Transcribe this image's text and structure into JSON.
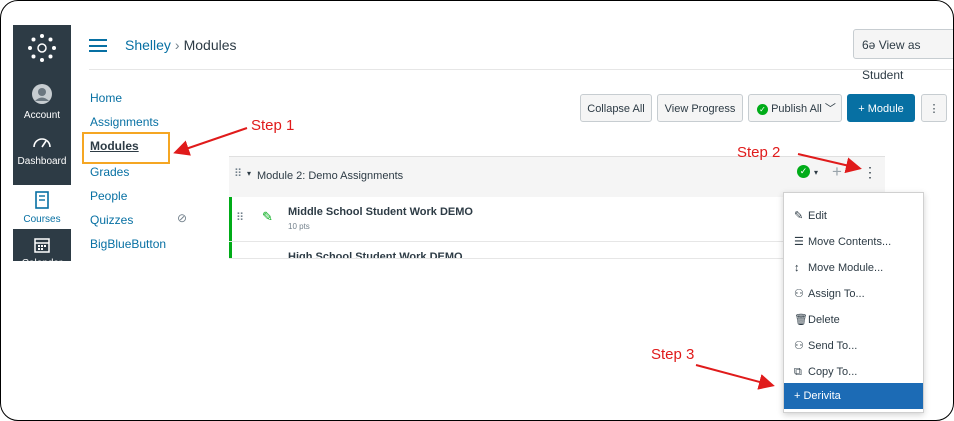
{
  "global_nav": {
    "account": "Account",
    "dashboard": "Dashboard",
    "courses": "Courses",
    "calendar": "Calendar"
  },
  "breadcrumb": {
    "course": "Shelley",
    "separator": "›",
    "page": "Modules"
  },
  "view_as_student": "View as Student",
  "course_nav": [
    "Home",
    "Assignments",
    "Modules",
    "Grades",
    "People",
    "Quizzes",
    "BigBlueButton"
  ],
  "toolbar": {
    "collapse_all": "Collapse All",
    "view_progress": "View Progress",
    "publish_all": "Publish All",
    "add_module": "+ Module",
    "more": "⋮"
  },
  "module": {
    "title": "Module 2: Demo Assignments"
  },
  "items": [
    {
      "title": "Middle School Student Work DEMO",
      "points": "10 pts"
    },
    {
      "title": "High School Student Work DEMO",
      "points": ""
    }
  ],
  "menu": [
    {
      "icon": "✎",
      "label": "Edit"
    },
    {
      "icon": "☰",
      "label": "Move Contents..."
    },
    {
      "icon": "↕",
      "label": "Move Module..."
    },
    {
      "icon": "⚇",
      "label": "Assign To..."
    },
    {
      "icon": "🗑",
      "label": "Delete"
    },
    {
      "icon": "⚇",
      "label": "Send To..."
    },
    {
      "icon": "⧉",
      "label": "Copy To..."
    },
    {
      "icon": "",
      "label": "+ Derivita"
    }
  ],
  "annotations": {
    "step1": "Step 1",
    "step2": "Step 2",
    "step3": "Step 3"
  },
  "colors": {
    "brand": "#0770a3",
    "nav_bg": "#2d3b45",
    "highlight": "#f5a623",
    "arrow": "#e01b1b",
    "publish": "#00ac18",
    "menu_selected": "#1c6bb5"
  }
}
